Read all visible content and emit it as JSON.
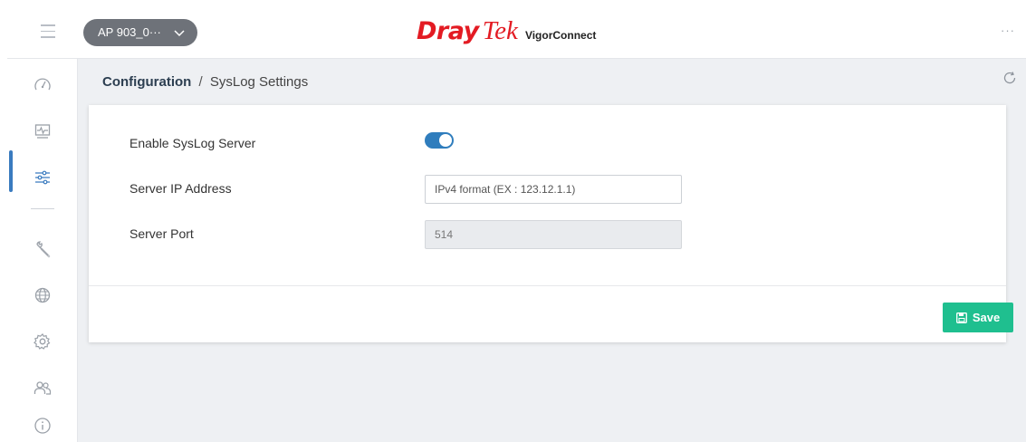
{
  "header": {
    "device_selector": "AP 903_0···",
    "brand": {
      "dray": "Dray",
      "tek": "Tek",
      "product": "VigorConnect"
    },
    "more_menu": "···"
  },
  "sidebar": {
    "items": [
      {
        "icon": "dashboard-gauge-icon"
      },
      {
        "icon": "monitoring-icon"
      },
      {
        "icon": "configuration-sliders-icon",
        "active": true
      },
      {
        "icon": "maintenance-wrench-icon"
      },
      {
        "icon": "globe-icon"
      },
      {
        "icon": "gear-icon"
      },
      {
        "icon": "users-icon"
      },
      {
        "icon": "info-icon"
      }
    ]
  },
  "breadcrumb": {
    "section": "Configuration",
    "separator": "/",
    "page": "SysLog Settings"
  },
  "form": {
    "enable_label": "Enable SysLog Server",
    "enable_value": true,
    "server_ip_label": "Server IP Address",
    "server_ip_placeholder": "IPv4 format (EX : 123.12.1.1)",
    "server_ip_value": "",
    "server_port_label": "Server Port",
    "server_port_value": "514"
  },
  "actions": {
    "save_label": "Save"
  },
  "colors": {
    "accent": "#2f7dbd",
    "save": "#1fbf8f",
    "brand_red": "#e31b23",
    "device_pill": "#6e7279"
  }
}
